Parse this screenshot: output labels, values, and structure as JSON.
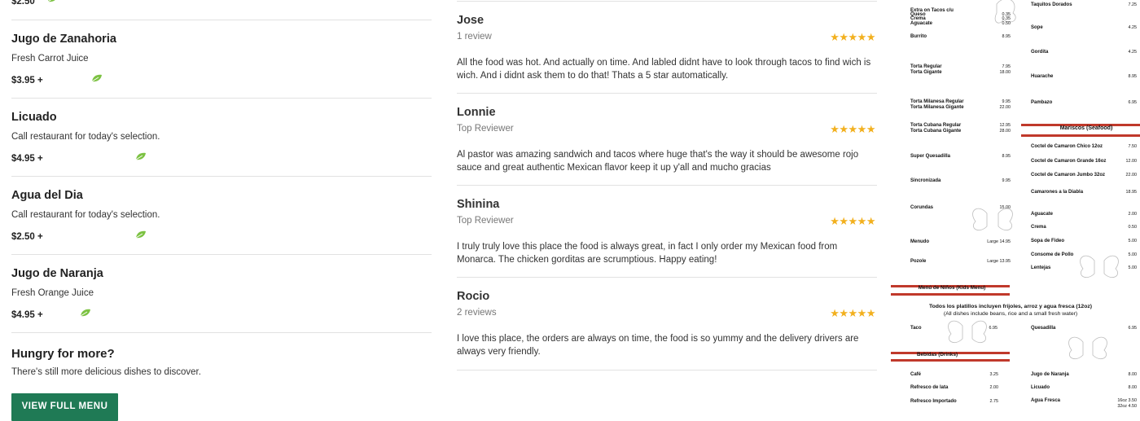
{
  "menu": {
    "top_price": "$2.50",
    "items": [
      {
        "name": "Jugo de Zanahoria",
        "description": "Fresh Carrot Juice",
        "price": "$3.95 +"
      },
      {
        "name": "Licuado",
        "description": "Call restaurant for today's selection.",
        "price": "$4.95 +"
      },
      {
        "name": "Agua del Dia",
        "description": "Call restaurant for today's selection.",
        "price": "$2.50 +"
      },
      {
        "name": "Jugo de Naranja",
        "description": "Fresh Orange Juice",
        "price": "$4.95 +"
      }
    ],
    "hungry_title": "Hungry for more?",
    "hungry_subtitle": "There's still more delicious dishes to discover.",
    "view_full_menu": "VIEW FULL MENU",
    "leaf_icon": "leaf-icon",
    "accent_color": "#1f7a55"
  },
  "reviews": [
    {
      "name": "Jose",
      "meta": "1 review",
      "rating": 5,
      "stars": "★★★★★",
      "text": "All the food was hot. And actually on time. And labled didnt have to look through tacos to find wich is wich. And i didnt ask them to do that! Thats a 5 star automatically."
    },
    {
      "name": "Lonnie",
      "meta": "Top Reviewer",
      "rating": 5,
      "stars": "★★★★★",
      "text": "Al pastor was amazing sandwich and tacos where huge that's the way it should be awesome rojo sauce and great authentic Mexican flavor keep it up y'all and mucho gracias"
    },
    {
      "name": "Shinina",
      "meta": "Top Reviewer",
      "rating": 5,
      "stars": "★★★★★",
      "text": "I truly truly love this place the food is always great, in fact I only order my Mexican food from Monarca. The chicken gorditas are scrumptious. Happy eating!"
    },
    {
      "name": "Rocio",
      "meta": "2 reviews",
      "rating": 5,
      "stars": "★★★★★",
      "text": "I love this place, the orders are always on time, the food is so yummy and the delivery drivers are always very friendly."
    }
  ],
  "menu_image": {
    "left": [
      {
        "name": "Extra on Tacos c/u",
        "price": ""
      },
      {
        "name": "Queso",
        "price": "0.35"
      },
      {
        "name": "Crema",
        "price": "0.35"
      },
      {
        "name": "Aguacate",
        "price": "0.50"
      },
      {
        "name": "Burrito",
        "price": "8.95"
      },
      {
        "name": "Torta Regular",
        "price": "7.95"
      },
      {
        "name": "Torta Gigante",
        "price": "18.00"
      },
      {
        "name": "Torta Milanesa Regular",
        "price": "9.95"
      },
      {
        "name": "Torta Milanesa Gigante",
        "price": "22.00"
      },
      {
        "name": "Torta Cubana Regular",
        "price": "12.95"
      },
      {
        "name": "Torta Cubana Gigante",
        "price": "28.00"
      },
      {
        "name": "Super Quesadilla",
        "price": "8.95"
      },
      {
        "name": "Sincronizada",
        "price": "9.95"
      },
      {
        "name": "Corundas",
        "price": "15.00"
      },
      {
        "name": "Menudo",
        "price": "Large 14.95"
      },
      {
        "name": "Pozole",
        "price": "Large 13.95"
      }
    ],
    "right": [
      {
        "name": "Taquitos Dorados",
        "price": "7.25"
      },
      {
        "name": "Sope",
        "price": "4.25"
      },
      {
        "name": "Gordita",
        "price": "4.25"
      },
      {
        "name": "Huarache",
        "price": "8.95"
      },
      {
        "name": "Pambazo",
        "price": "6.95"
      }
    ],
    "mariscos_title": "Mariscos (Seafood)",
    "mariscos": [
      {
        "name": "Coctel de Camaron Chico 12oz",
        "price": "7.50"
      },
      {
        "name": "Coctel de Camaron Grande 16oz",
        "price": "12.00"
      },
      {
        "name": "Coctel de Camaron Jumbo 32oz",
        "price": "22.00"
      },
      {
        "name": "Camarones a la Diabla",
        "price": "18.95"
      },
      {
        "name": "Aguacate",
        "price": "2.00"
      },
      {
        "name": "Crema",
        "price": "0.50"
      },
      {
        "name": "Sopa de Fideo",
        "price": "5.00"
      },
      {
        "name": "Consome de Pollo",
        "price": "5.00"
      },
      {
        "name": "Lentejas",
        "price": "5.00"
      }
    ],
    "kids_title": "Menú de Niños (Kids Menu)",
    "kids_note_1": "Todos los platillos incluyen frijoles, arroz y agua fresca (12oz)",
    "kids_note_2": "(All dishes include beans, rice and a small fresh water)",
    "kids": [
      {
        "name": "Taco",
        "price": "6.95"
      },
      {
        "name": "Quesadilla",
        "price": "6.95"
      }
    ],
    "drinks_title": "Bebidas (Drinks)",
    "drinks_left": [
      {
        "name": "Café",
        "price": "3.25"
      },
      {
        "name": "Refresco de lata",
        "price": "2.00"
      },
      {
        "name": "Refresco Importado",
        "price": "2.75"
      }
    ],
    "drinks_right": [
      {
        "name": "Jugo de Naranja",
        "price": "8.00"
      },
      {
        "name": "Licuado",
        "price": "8.00"
      },
      {
        "name": "Agua Fresca",
        "price": "16oz 3.50"
      },
      {
        "name": "",
        "price": "32oz 4.50"
      }
    ]
  }
}
